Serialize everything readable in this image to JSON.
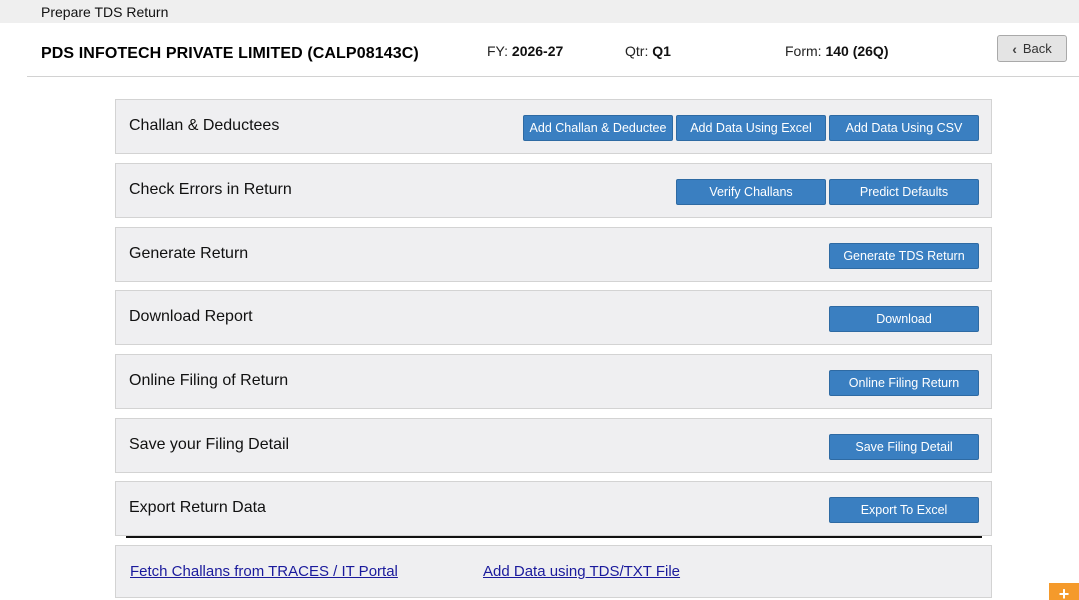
{
  "window": {
    "title": "Prepare TDS Return"
  },
  "header": {
    "company": "PDS INFOTECH PRIVATE LIMITED (CALP08143C)",
    "fy_label": "FY:",
    "fy_value": "2026-27",
    "qtr_label": "Qtr:",
    "qtr_value": "Q1",
    "form_label": "Form:",
    "form_value": "140 (26Q)",
    "back_label": "Back"
  },
  "sections": [
    {
      "label": "Challan & Deductees",
      "buttons": [
        "Add Challan & Deductee",
        "Add Data Using Excel",
        "Add Data Using CSV"
      ]
    },
    {
      "label": "Check Errors in Return",
      "buttons": [
        "Verify Challans",
        "Predict Defaults"
      ]
    },
    {
      "label": "Generate Return",
      "buttons": [
        "Generate TDS Return"
      ]
    },
    {
      "label": "Download Report",
      "buttons": [
        "Download"
      ]
    },
    {
      "label": "Online Filing of Return",
      "buttons": [
        "Online Filing Return"
      ]
    },
    {
      "label": "Save your Filing Detail",
      "buttons": [
        "Save Filing Detail"
      ]
    },
    {
      "label": "Export Return Data",
      "buttons": [
        "Export To Excel"
      ]
    }
  ],
  "links": {
    "fetch_challans": "Fetch Challans from TRACES / IT Portal",
    "add_tds_txt": "Add Data using TDS/TXT File"
  },
  "fab": {
    "symbol": "+"
  },
  "colors": {
    "button_blue": "#3a7fc1",
    "section_bg": "#efeff1",
    "link_color": "#1a1a9c",
    "fab_orange": "#f59a2b"
  }
}
